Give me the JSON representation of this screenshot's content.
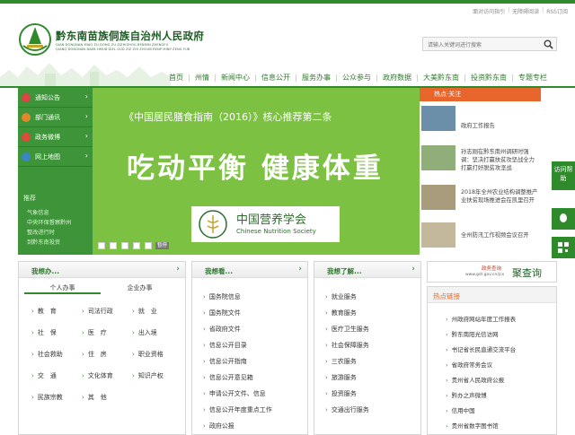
{
  "top_links": [
    "面对访问指引",
    "无障碍阅读",
    "RSS订阅"
  ],
  "header": {
    "title": "黔东南苗族侗族自治州人民政府",
    "subtitle1": "QIAN DONGNAN MIAO ZU DONG ZU ZIZHIZHOU RENMIN ZHENGFU",
    "subtitle2": "QIANQ DONGNAN DAEB HMUB DIEL GUD ZIZ ZHI ZHOUB RENP MINP ZENG FUB",
    "search_placeholder": "请输入关键词进行搜索"
  },
  "nav": [
    "首页",
    "州情",
    "新闻中心",
    "信息公开",
    "服务办事",
    "公众参与",
    "政府数据",
    "大美黔东南",
    "投资黔东南",
    "专题专栏"
  ],
  "sidebar": {
    "items": [
      "通知公告",
      "部门通讯",
      "政务微博",
      "网上地图"
    ],
    "lower_head": "推荐",
    "lower_lines": [
      "气象信息",
      "中央环保督察黔州",
      "整改进行时",
      "到黔东南投资"
    ]
  },
  "banner": {
    "line1": "《中国居民膳食指南（2016）》核心推荐第二条",
    "line2": "吃动平衡 健康体重",
    "org_zh": "中国营养学会",
    "org_en": "Chinese Nutrition Society",
    "pause": "暂停"
  },
  "hot": {
    "head": "热点·关注",
    "items": [
      "政府工作报告",
      "孙志刚在黔东南州调研时强调：坚决打赢扶贫攻坚战全力打赢打好脱贫攻坚战",
      "2018年全州农业结构调整推产业扶贫现场推进会在凯里召开",
      "全州防汛工作视频会议召开"
    ]
  },
  "right_float": [
    "访问帮助"
  ],
  "panel_i_do": {
    "title": "我想办...",
    "tabs": [
      "个人办事",
      "企业办事"
    ],
    "grid": [
      "教　育",
      "司法行政",
      "就　业",
      "社　保",
      "医　疗",
      "出入境",
      "社会救助",
      "住　房",
      "职业资格",
      "交　通",
      "文化体育",
      "知识产权",
      "民族宗教",
      "其　他"
    ]
  },
  "panel_i_see": {
    "title": "我想看...",
    "items": [
      "国务院信息",
      "国务院文件",
      "省政府文件",
      "信息公开目录",
      "信息公开指南",
      "信息公开意见箱",
      "申请公开文件、信息",
      "信息公开年度重点工作",
      "政府公报"
    ]
  },
  "panel_i_know": {
    "title": "我想了解...",
    "items": [
      "就业服务",
      "教育服务",
      "医疗卫生服务",
      "社会保障服务",
      "三农服务",
      "旅游服务",
      "投资服务",
      "交通出行服务"
    ]
  },
  "gov_query": {
    "small": "政务查询",
    "url": "www.gdr.gov.cn/jcx",
    "big": "聚查询"
  },
  "hot_links": {
    "title": "热点链接",
    "items": [
      "州政府网站年度工作报表",
      "黔东南阳光信访网",
      "书记省长民直通交流平台",
      "省政府常务会议",
      "贵州省人民政府公报",
      "黔办之声微博",
      "信用中国",
      "贵州省数字图书馆"
    ]
  }
}
